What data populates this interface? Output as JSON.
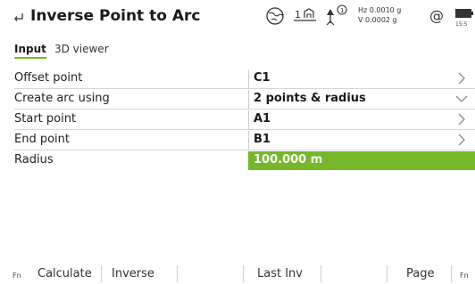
{
  "header": {
    "title": "Inverse Point to Arc",
    "back_icon": "back-arrow-icon",
    "tilt": {
      "hz": "Hz 0.0010 g",
      "v": "V  0.0002 g"
    },
    "time": "15:5",
    "icons": [
      "globe-icon",
      "instrument-count-icon",
      "prism-icon",
      "at-icon",
      "battery-icon"
    ]
  },
  "tabs": [
    {
      "label": "Input",
      "active": true
    },
    {
      "label": "3D viewer",
      "active": false
    }
  ],
  "form": {
    "rows": [
      {
        "label": "Offset point",
        "value": "C1",
        "control": "chevron-right"
      },
      {
        "label": "Create arc using",
        "value": "2 points & radius",
        "control": "chevron-down"
      },
      {
        "label": "Start point",
        "value": "A1",
        "control": "chevron-right"
      },
      {
        "label": "End point",
        "value": "B1",
        "control": "chevron-right"
      },
      {
        "label": "Radius",
        "value": "100.000 m",
        "control": "none"
      }
    ]
  },
  "softkeys": {
    "fn_left": "Fn",
    "calculate": "Calculate",
    "inverse": "Inverse",
    "last_inv": "Last Inv",
    "page": "Page",
    "fn_right": "Fn"
  },
  "colors": {
    "accent_green": "#76b82a",
    "tab_underline": "#79b829"
  }
}
